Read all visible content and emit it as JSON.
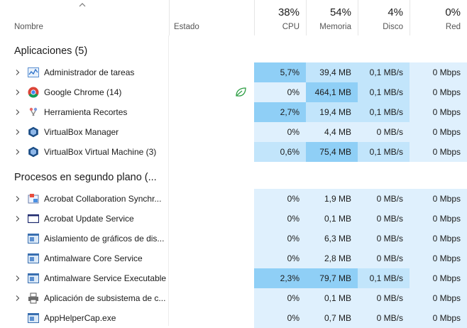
{
  "header": {
    "name_label": "Nombre",
    "status_label": "Estado",
    "cpu_pct": "38%",
    "cpu_label": "CPU",
    "mem_pct": "54%",
    "mem_label": "Memoria",
    "disk_pct": "4%",
    "disk_label": "Disco",
    "net_pct": "0%",
    "net_label": "Red"
  },
  "sections": {
    "apps": "Aplicaciones (5)",
    "background": "Procesos en segundo plano (..."
  },
  "apps": [
    {
      "name": "Administrador de tareas",
      "icon": "task-manager-icon",
      "cpu": "5,7%",
      "mem": "39,4 MB",
      "disk": "0,1 MB/s",
      "net": "0 Mbps"
    },
    {
      "name": "Google Chrome (14)",
      "icon": "chrome-icon",
      "cpu": "0%",
      "mem": "464,1 MB",
      "disk": "0,1 MB/s",
      "net": "0 Mbps",
      "eco": true
    },
    {
      "name": "Herramienta Recortes",
      "icon": "snipping-tool-icon",
      "cpu": "2,7%",
      "mem": "19,4 MB",
      "disk": "0,1 MB/s",
      "net": "0 Mbps"
    },
    {
      "name": "VirtualBox Manager",
      "icon": "virtualbox-icon",
      "cpu": "0%",
      "mem": "4,4 MB",
      "disk": "0 MB/s",
      "net": "0 Mbps"
    },
    {
      "name": "VirtualBox Virtual Machine (3)",
      "icon": "virtualbox-icon",
      "cpu": "0,6%",
      "mem": "75,4 MB",
      "disk": "0,1 MB/s",
      "net": "0 Mbps"
    }
  ],
  "background": [
    {
      "name": "Acrobat Collaboration Synchr...",
      "icon": "acrobat-sync-icon",
      "cpu": "0%",
      "mem": "1,9 MB",
      "disk": "0 MB/s",
      "net": "0 Mbps"
    },
    {
      "name": "Acrobat Update Service",
      "icon": "window-icon",
      "cpu": "0%",
      "mem": "0,1 MB",
      "disk": "0 MB/s",
      "net": "0 Mbps"
    },
    {
      "name": "Aislamiento de gráficos de dis...",
      "icon": "service-icon",
      "cpu": "0%",
      "mem": "6,3 MB",
      "disk": "0 MB/s",
      "net": "0 Mbps"
    },
    {
      "name": "Antimalware Core Service",
      "icon": "service-icon",
      "cpu": "0%",
      "mem": "2,8 MB",
      "disk": "0 MB/s",
      "net": "0 Mbps"
    },
    {
      "name": "Antimalware Service Executable",
      "icon": "service-icon",
      "cpu": "2,3%",
      "mem": "79,7 MB",
      "disk": "0,1 MB/s",
      "net": "0 Mbps"
    },
    {
      "name": "Aplicación de subsistema de c...",
      "icon": "printer-icon",
      "cpu": "0%",
      "mem": "0,1 MB",
      "disk": "0 MB/s",
      "net": "0 Mbps"
    },
    {
      "name": "AppHelperCap.exe",
      "icon": "service-icon",
      "cpu": "0%",
      "mem": "0,7 MB",
      "disk": "0 MB/s",
      "net": "0 Mbps"
    }
  ]
}
